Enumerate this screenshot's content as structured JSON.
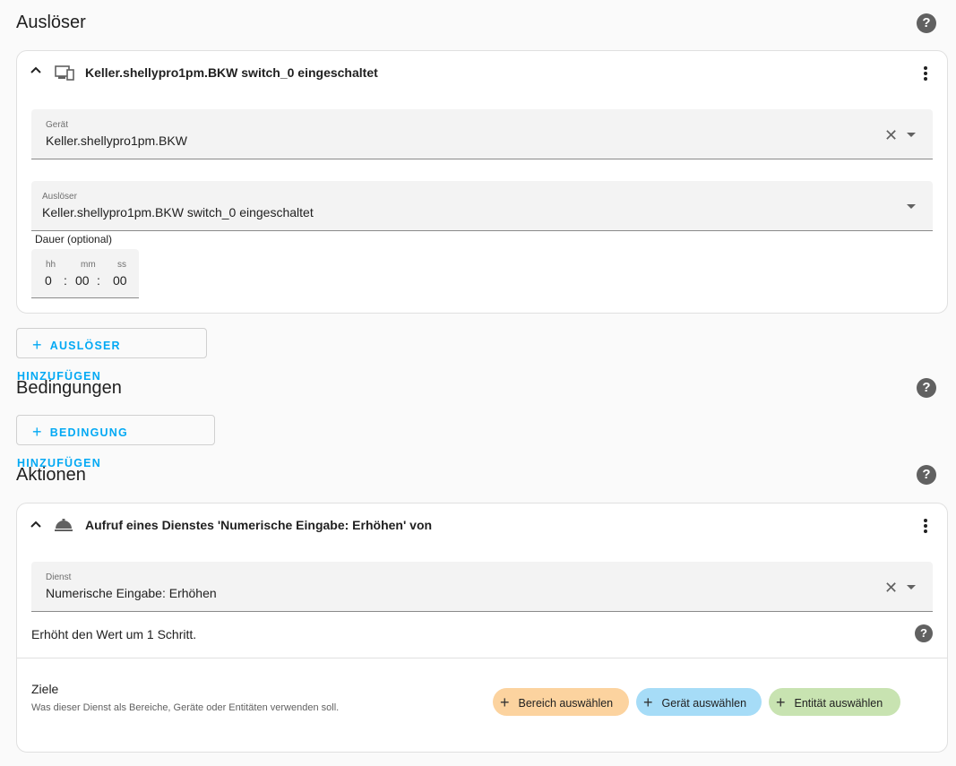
{
  "triggers": {
    "title": "Auslöser",
    "card": {
      "header": "Keller.shellypro1pm.BKW switch_0 eingeschaltet",
      "device_field": {
        "label": "Gerät",
        "value": "Keller.shellypro1pm.BKW"
      },
      "trigger_field": {
        "label": "Auslöser",
        "value": "Keller.shellypro1pm.BKW switch_0 eingeschaltet"
      },
      "duration": {
        "label": "Dauer (optional)",
        "hh_label": "hh",
        "mm_label": "mm",
        "ss_label": "ss",
        "hh": "0",
        "mm": "00",
        "ss": "00",
        "sep": ":"
      }
    },
    "add_button": "AUSLÖSER HINZUFÜGEN"
  },
  "conditions": {
    "title": "Bedingungen",
    "add_button": "BEDINGUNG HINZUFÜGEN"
  },
  "actions": {
    "title": "Aktionen",
    "card": {
      "header": "Aufruf eines Dienstes 'Numerische Eingabe: Erhöhen' von",
      "service_field": {
        "label": "Dienst",
        "value": "Numerische Eingabe: Erhöhen"
      },
      "description": "Erhöht den Wert um 1 Schritt.",
      "targets": {
        "title": "Ziele",
        "subtitle": "Was dieser Dienst als Bereiche, Geräte oder Entitäten verwenden soll.",
        "area_button": "Bereich auswählen",
        "device_button": "Gerät auswählen",
        "entity_button": "Entität auswählen"
      }
    }
  },
  "icons": {
    "help": "?",
    "plus": "+",
    "clear": "✕",
    "chevron": "^"
  },
  "colors": {
    "accent": "#03a9f4",
    "area_pill": "#fcd39f",
    "device_pill": "#a6dcf7",
    "entity_pill": "#c8e3b1"
  }
}
